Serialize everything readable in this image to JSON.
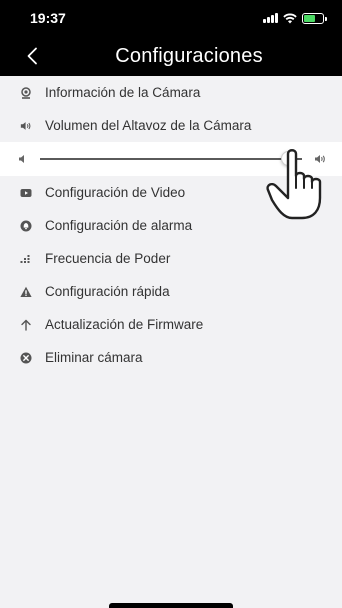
{
  "status": {
    "time": "19:37"
  },
  "navbar": {
    "title": "Configuraciones"
  },
  "items": [
    {
      "label": "Información de la Cámara",
      "icon": "webcam-icon"
    },
    {
      "label": "Volumen del Altavoz de la Cámara",
      "icon": "speaker-icon"
    },
    {
      "label": "Configuración de Video",
      "icon": "video-icon"
    },
    {
      "label": "Configuración de alarma",
      "icon": "alarm-icon"
    },
    {
      "label": "Frecuencia de Poder",
      "icon": "frequency-icon"
    },
    {
      "label": "Configuración rápida",
      "icon": "warning-icon"
    },
    {
      "label": "Actualización de Firmware",
      "icon": "arrow-up-icon"
    },
    {
      "label": "Eliminar cámara",
      "icon": "delete-icon"
    }
  ],
  "volume": {
    "level": 0.95
  },
  "colors": {
    "icon": "#555555",
    "text": "#333333",
    "header": "#000000",
    "background": "#f2f2f4"
  }
}
